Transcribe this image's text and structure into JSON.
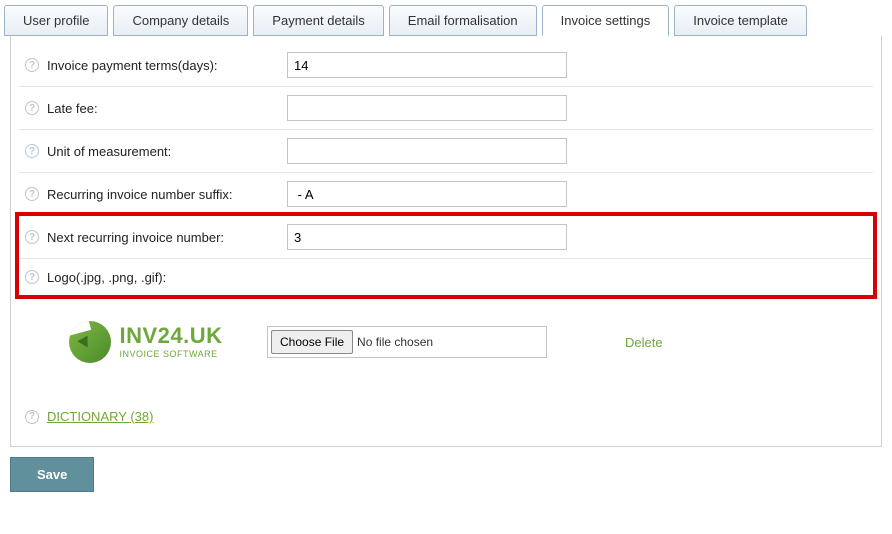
{
  "tabs": {
    "user_profile": "User profile",
    "company_details": "Company details",
    "payment_details": "Payment details",
    "email_formalisation": "Email formalisation",
    "invoice_settings": "Invoice settings",
    "invoice_template": "Invoice template"
  },
  "form": {
    "payment_terms": {
      "label": "Invoice payment terms(days):",
      "value": "14"
    },
    "late_fee": {
      "label": "Late fee:",
      "value": ""
    },
    "unit": {
      "label": "Unit of measurement:",
      "value": ""
    },
    "suffix": {
      "label": "Recurring invoice number suffix:",
      "value": " - A"
    },
    "next_number": {
      "label": "Next recurring invoice number:",
      "value": "3"
    },
    "logo": {
      "label": "Logo(.jpg, .png, .gif):"
    }
  },
  "logo_preview": {
    "title": "INV24.UK",
    "subtitle": "INVOICE SOFTWARE"
  },
  "file": {
    "choose": "Choose File",
    "status": "No file chosen",
    "delete": "Delete"
  },
  "dictionary": "DICTIONARY (38)",
  "save": "Save",
  "help_glyph": "?"
}
